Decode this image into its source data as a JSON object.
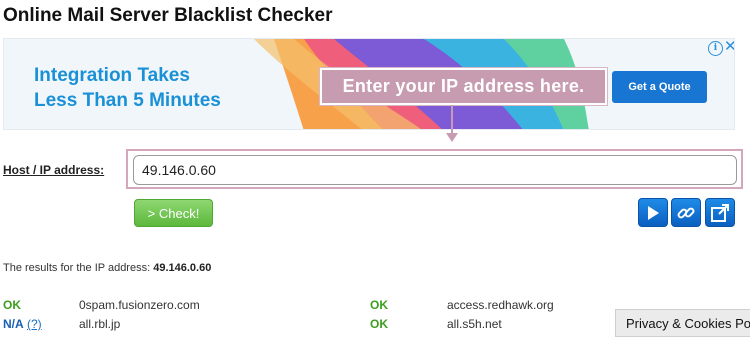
{
  "page": {
    "title": "Online Mail Server Blacklist Checker"
  },
  "ad": {
    "headline_line1": "Integration Takes",
    "headline_line2": "Less Than 5 Minutes",
    "cta_label": "Get a Quote",
    "info_glyph": "i",
    "close_glyph": "✕",
    "colors": {
      "headline": "#1a91d6",
      "cta": "#1975d2"
    }
  },
  "annotation": {
    "text": "Enter your IP address here."
  },
  "form": {
    "host_label": "Host / IP address:",
    "ip_value": "49.146.0.60",
    "check_label": "> Check!",
    "icons": [
      "play-icon",
      "link-icon",
      "external-link-icon"
    ]
  },
  "results": {
    "summary_prefix": "The results for the IP address:",
    "ip": "49.146.0.60",
    "rows": [
      {
        "status": "OK",
        "server": "0spam.fusionzero.com"
      },
      {
        "status": "OK",
        "server": "access.redhawk.org"
      },
      {
        "status": "N/A",
        "help": "(?)",
        "server": "all.rbl.jp"
      },
      {
        "status": "OK",
        "server": "all.s5h.net"
      }
    ]
  },
  "footer": {
    "privacy_label": "Privacy & Cookies Po"
  }
}
